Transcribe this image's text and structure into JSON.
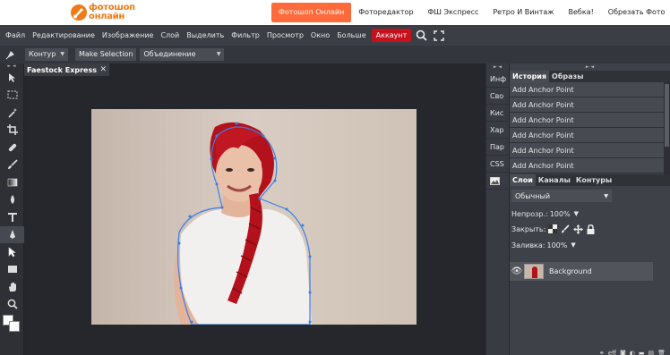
{
  "brand": {
    "logo_line1": "фотошоп",
    "logo_line2": "онлайн",
    "logo_color": "#f07a18"
  },
  "top_nav": [
    {
      "label": "Фотошоп Онлайн",
      "active": true
    },
    {
      "label": "Фоторедактор"
    },
    {
      "label": "ФШ Экспресс"
    },
    {
      "label": "Ретро И Винтаж"
    },
    {
      "label": "Вебка!"
    },
    {
      "label": "Обрезать Фото"
    }
  ],
  "menu": {
    "items": [
      "Файл",
      "Редактирование",
      "Изображение",
      "Слой",
      "Выделить",
      "Фильтр",
      "Просмотр",
      "Окно",
      "Больше"
    ],
    "account": "Аккаунт",
    "account_color": "#c5121e",
    "icons": [
      "search-icon",
      "fullscreen-icon"
    ]
  },
  "options": {
    "tool_icon": "pen-icon",
    "mode_select": "Контур",
    "make_selection": "Make Selection",
    "combine_select": "Объединение"
  },
  "tools": [
    "move-icon",
    "marquee-icon",
    "magic-wand-icon",
    "crop-icon",
    "healing-icon",
    "brush-icon",
    "eraser-icon",
    "gradient-icon",
    "blur-icon",
    "type-icon",
    "pen-icon",
    "path-select-icon",
    "shape-icon",
    "hand-icon",
    "zoom-icon"
  ],
  "document": {
    "tab_title": "Faestock Expressio",
    "close": "✕"
  },
  "mini_panel": {
    "arrows": "► ◄",
    "items": [
      "Инф",
      "Сво",
      "Кис",
      "Хар",
      "Пар",
      "CSS"
    ]
  },
  "history": {
    "arrows": "► ◄",
    "tabs": [
      "История",
      "Образы"
    ],
    "rows": [
      "Add Anchor Point",
      "Add Anchor Point",
      "Add Anchor Point",
      "Add Anchor Point",
      "Add Anchor Point",
      "Add Anchor Point"
    ]
  },
  "layers": {
    "tabs": [
      "Слои",
      "Каналы",
      "Контуры"
    ],
    "blend_mode": "Обычный",
    "opacity_label": "Непрозр.:",
    "opacity_value": "100%",
    "lock_label": "Закрыть:",
    "fill_label": "Заливка:",
    "fill_value": "100%",
    "layer_name": "Background",
    "bottom_icons": [
      "link-icon",
      "effects-icon",
      "mask-icon",
      "adjustment-icon",
      "folder-icon",
      "new-layer-icon",
      "trash-icon"
    ],
    "effects_label": "eff"
  }
}
